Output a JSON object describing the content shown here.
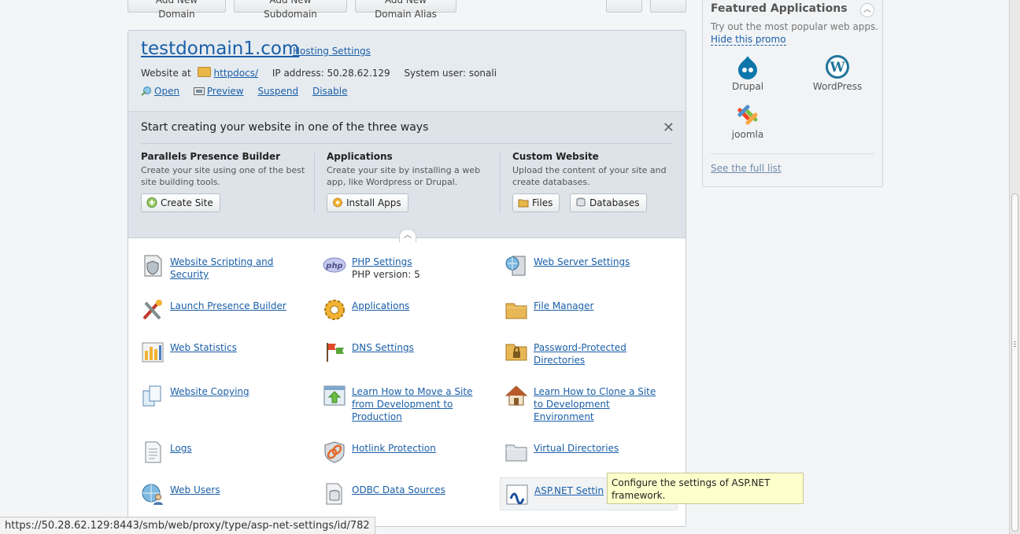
{
  "top_buttons": [
    "Add New Domain",
    "Add New Subdomain",
    "Add New Domain Alias"
  ],
  "domain": {
    "name": "testdomain1.com",
    "hosting_settings": "Hosting Settings",
    "website_at": "Website at",
    "docroot": "httpdocs/",
    "ip_label": "IP address: 50.28.62.129",
    "system_user": "System user: sonali",
    "actions": [
      "Open",
      "Preview",
      "Suspend",
      "Disable"
    ]
  },
  "start": {
    "title": "Start creating your website in one of the three ways",
    "close_icon": "close-icon",
    "columns": [
      {
        "title": "Parallels Presence Builder",
        "desc": "Create your site using one of the best site building tools.",
        "buttons": [
          "Create Site"
        ]
      },
      {
        "title": "Applications",
        "desc": "Create your site by installing a web app, like Wordpress or Drupal.",
        "buttons": [
          "Install Apps"
        ]
      },
      {
        "title": "Custom Website",
        "desc": "Upload the content of your site and create databases.",
        "buttons": [
          "Files",
          "Databases"
        ]
      }
    ]
  },
  "tools": [
    {
      "label": "Website Scripting and Security",
      "icon": "shield-doc-icon"
    },
    {
      "label": "PHP Settings",
      "sub": "PHP version: 5",
      "icon": "php-icon"
    },
    {
      "label": "Web Server Settings",
      "icon": "server-icon"
    },
    {
      "label": "Launch Presence Builder",
      "icon": "tools-icon"
    },
    {
      "label": "Applications",
      "icon": "gear-icon"
    },
    {
      "label": "File Manager",
      "icon": "folder-icon"
    },
    {
      "label": "Web Statistics",
      "icon": "bar-chart-icon"
    },
    {
      "label": "DNS Settings",
      "icon": "flags-icon"
    },
    {
      "label": "Password-Protected Directories",
      "icon": "locked-folder-icon"
    },
    {
      "label": "Website Copying",
      "icon": "copy-icon"
    },
    {
      "label": "Learn How to Move a Site from Development to Production",
      "icon": "upload-icon"
    },
    {
      "label": "Learn How to Clone a Site to Development Environment",
      "icon": "house-icon"
    },
    {
      "label": "Logs",
      "icon": "log-icon"
    },
    {
      "label": "Hotlink Protection",
      "icon": "chain-shield-icon"
    },
    {
      "label": "Virtual Directories",
      "icon": "virtual-folder-icon"
    },
    {
      "label": "Web Users",
      "icon": "web-users-icon"
    },
    {
      "label": "ODBC Data Sources",
      "icon": "database-icon"
    },
    {
      "label": "ASP.NET Settin",
      "icon": "aspnet-icon"
    }
  ],
  "featured": {
    "title": "Featured Applications",
    "tryout": "Try out the most popular web apps.",
    "hide": "Hide this promo",
    "apps": [
      "Drupal",
      "WordPress",
      "joomla"
    ],
    "full_list": "See the full list"
  },
  "tooltip": "Configure the settings of ASP.NET framework.",
  "status_url": "https://50.28.62.129:8443/smb/web/proxy/type/asp-net-settings/id/782"
}
